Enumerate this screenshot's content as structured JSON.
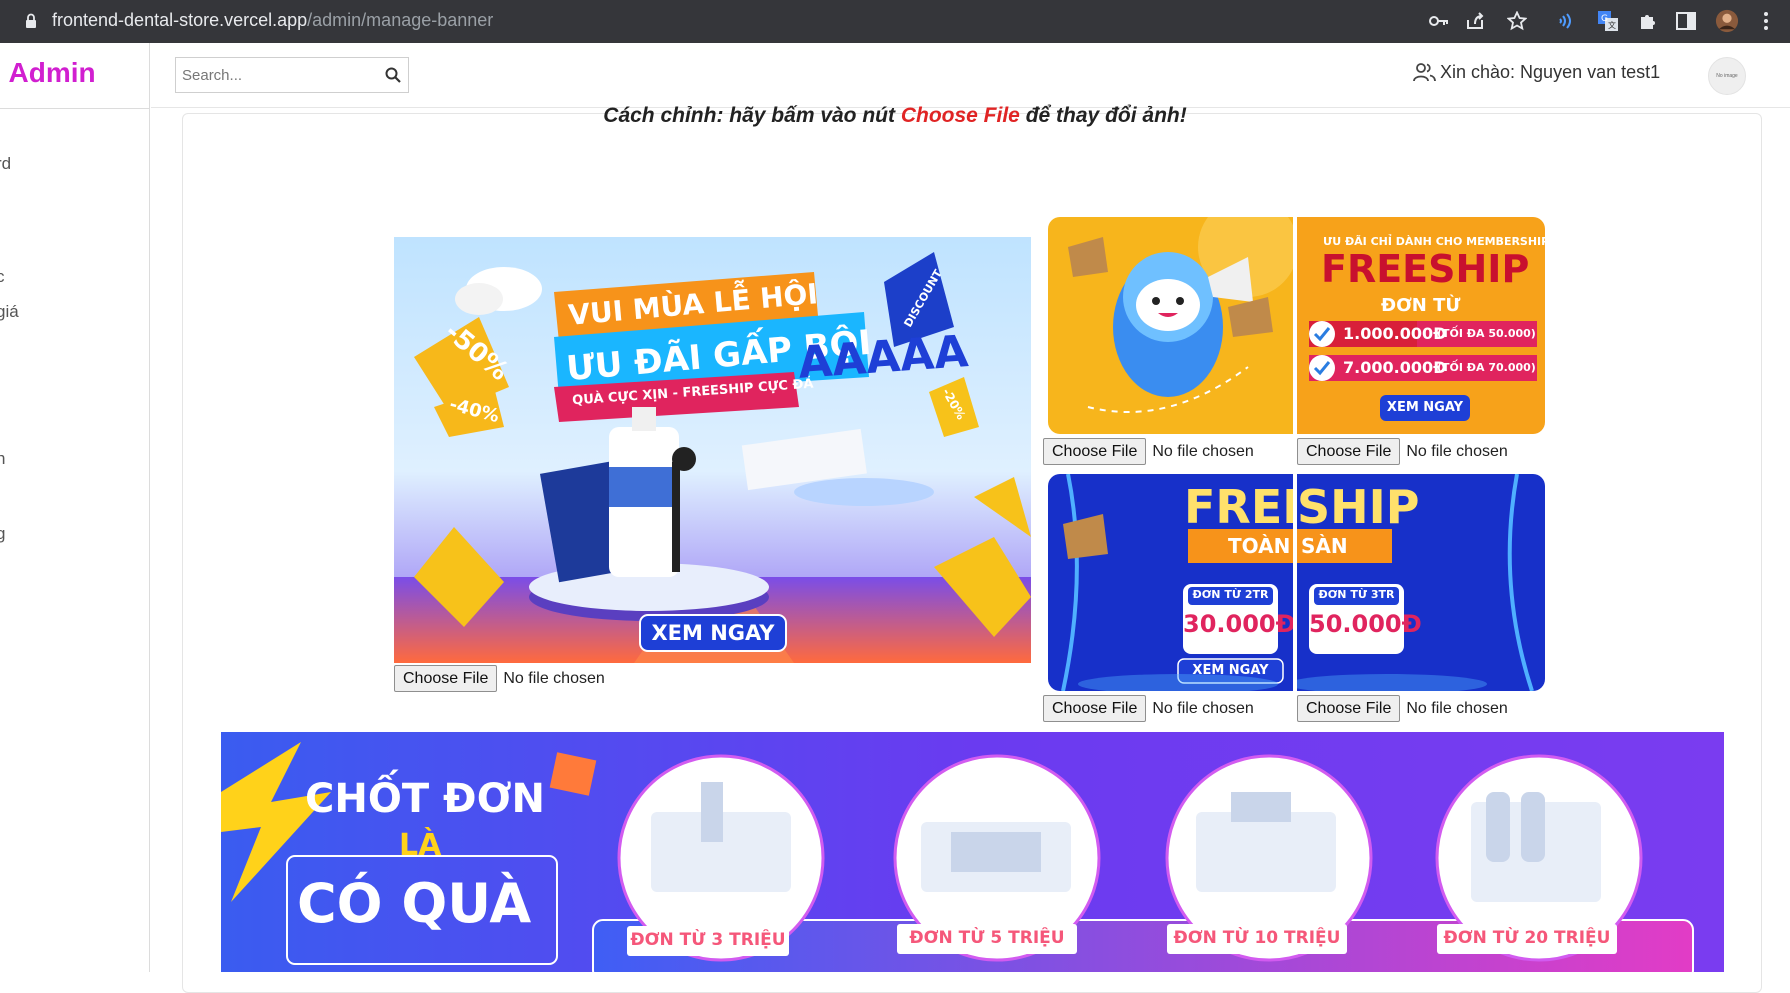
{
  "browser": {
    "url_host": "frontend-dental-store.vercel.app",
    "url_path": "/admin/manage-banner"
  },
  "sidebar": {
    "brand": "l Admin",
    "items": [
      {
        "label": "rd"
      },
      {
        "label": "c"
      },
      {
        "label": "giá"
      },
      {
        "label": ":"
      },
      {
        "label": "n"
      },
      {
        "label": "g"
      }
    ]
  },
  "topbar": {
    "search_placeholder": "Search...",
    "greeting": "Xin chào: Nguyen van test1",
    "avatar_text": "No image"
  },
  "instruction": {
    "prefix": "Cách chỉnh: hãy bấm vào nút ",
    "highlight": "Choose File",
    "suffix": " để thay đổi ảnh!"
  },
  "file_input": {
    "button_label": "Choose File",
    "status": "No file chosen"
  },
  "banners": {
    "main": {
      "line1": "VUI MÙA LỄ HỘI",
      "line2": "ƯU ĐÃI GẤP BỘI",
      "line3": "QUÀ CỰC XỊN - FREESHIP CỰC ĐÃ",
      "aaa": "AAAAA",
      "badge_50": "-50%",
      "badge_40": "-40%",
      "badge_20": "-20%",
      "discount": "DISCOUNT",
      "cta": "XEM NGAY"
    },
    "freeship_member": {
      "top": "ƯU ĐÃI CHỈ DÀNH CHO MEMBERSHIP",
      "title": "FREESHIP",
      "sub": "ĐƠN TỪ",
      "row1_amount": "1.000.000Đ",
      "row1_note": "(TỐI ĐA 50.000)",
      "row2_amount": "7.000.000Đ",
      "row2_note": "(TỐI ĐA 70.000)",
      "cta": "XEM NGAY"
    },
    "freeship_all": {
      "title_left": "FREE",
      "title_right": "SHIP",
      "sub_left": "TOÀN",
      "sub_right": "SÀN",
      "box1_top": "ĐƠN TỪ 2TR",
      "box1_value": "30.000Đ",
      "box2_top": "ĐƠN TỪ 3TR",
      "box2_value": "50.000Đ",
      "cta": "XEM NGAY"
    },
    "bottom": {
      "line1": "CHỐT ĐƠN",
      "line2": "LÀ",
      "line3": "CÓ QUÀ",
      "tiers": [
        "ĐƠN TỪ 3 TRIỆU",
        "ĐƠN TỪ 5 TRIỆU",
        "ĐƠN TỪ 10 TRIỆU",
        "ĐƠN TỪ 20 TRIỆU"
      ]
    }
  },
  "colors": {
    "brand": "#d11fd0",
    "highlight": "#e02424",
    "orange": "#f7a21a",
    "blue": "#1e3fd6",
    "purple": "#6a3bf0"
  }
}
